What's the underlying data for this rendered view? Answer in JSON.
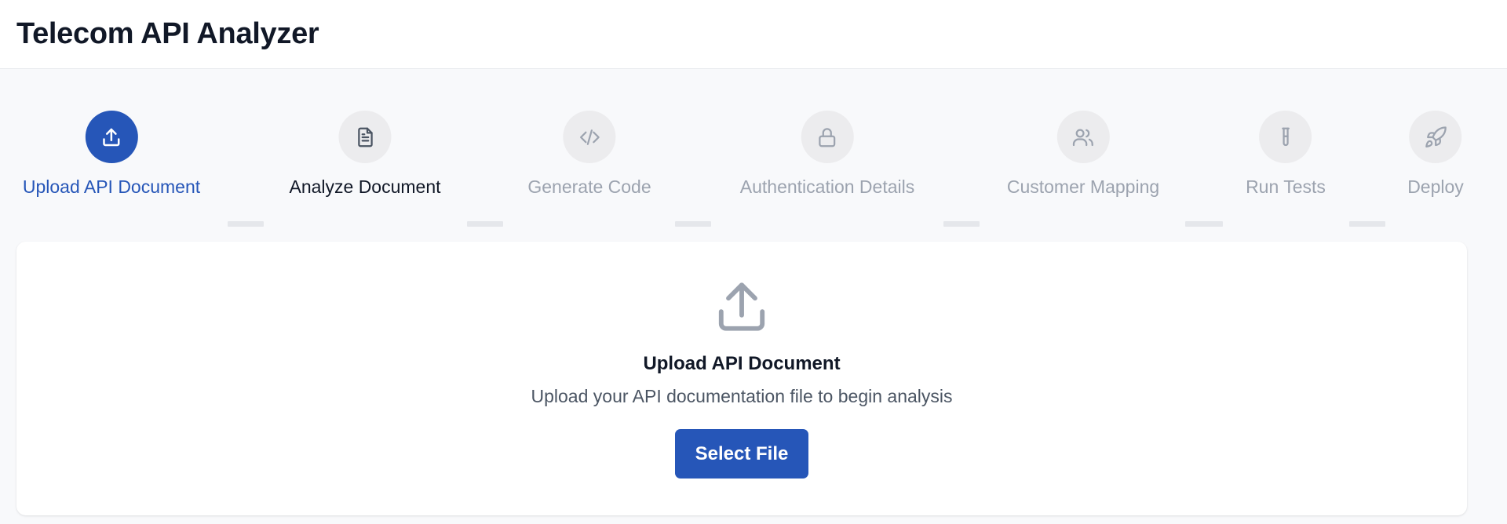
{
  "app": {
    "title": "Telecom API Analyzer"
  },
  "steps": [
    {
      "label": "Upload API Document",
      "icon": "upload-icon",
      "state": "active"
    },
    {
      "label": "Analyze Document",
      "icon": "document-icon",
      "state": "next"
    },
    {
      "label": "Generate Code",
      "icon": "code-icon",
      "state": "pending"
    },
    {
      "label": "Authentication Details",
      "icon": "lock-icon",
      "state": "pending"
    },
    {
      "label": "Customer Mapping",
      "icon": "users-icon",
      "state": "pending"
    },
    {
      "label": "Run Tests",
      "icon": "test-tube-icon",
      "state": "pending"
    },
    {
      "label": "Deploy",
      "icon": "rocket-icon",
      "state": "pending"
    }
  ],
  "upload": {
    "icon": "upload-icon",
    "title": "Upload API Document",
    "description": "Upload your API documentation file to begin analysis",
    "button_label": "Select File"
  },
  "colors": {
    "accent": "#2656b8",
    "inactive": "#9ca3af",
    "background": "#f8f9fb",
    "surface": "#ffffff"
  }
}
